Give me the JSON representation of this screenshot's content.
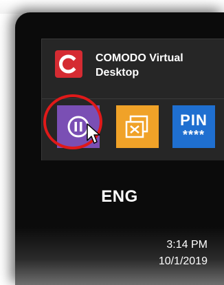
{
  "popup": {
    "app_name": "COMODO Virtual Desktop",
    "app_logo_letter": "C",
    "tiles": [
      {
        "name": "pause",
        "color": "#7a4fb4"
      },
      {
        "name": "close-virtual-desktop",
        "color": "#f0a228"
      },
      {
        "name": "pin",
        "label": "PIN",
        "mask": "****",
        "color": "#1f6fd0"
      }
    ]
  },
  "taskbar": {
    "language": "ENG",
    "time": "3:14 PM",
    "date": "10/1/2019"
  },
  "colors": {
    "brand_red": "#d52b32",
    "highlight_ring": "#e01919"
  }
}
